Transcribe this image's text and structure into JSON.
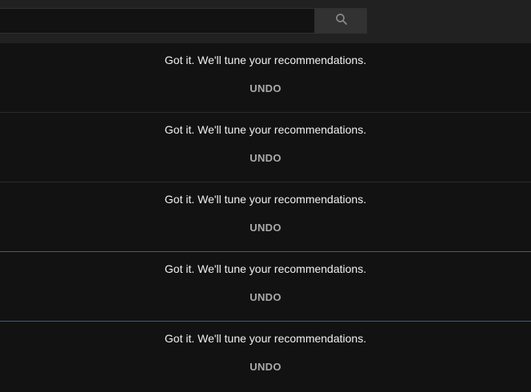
{
  "search": {
    "value": "",
    "placeholder": "",
    "button_icon": "search-icon"
  },
  "rows": [
    {
      "message": "Got it. We'll tune your recommendations.",
      "undo_label": "UNDO"
    },
    {
      "message": "Got it. We'll tune your recommendations.",
      "undo_label": "UNDO"
    },
    {
      "message": "Got it. We'll tune your recommendations.",
      "undo_label": "UNDO"
    },
    {
      "message": "Got it. We'll tune your recommendations.",
      "undo_label": "UNDO"
    },
    {
      "message": "Got it. We'll tune your recommendations.",
      "undo_label": "UNDO"
    }
  ],
  "colors": {
    "background": "#121212",
    "topbar": "#212121",
    "accent_border": "#3e5c8f",
    "text": "#f1f1f1",
    "undo_text": "#aaaaaa"
  }
}
